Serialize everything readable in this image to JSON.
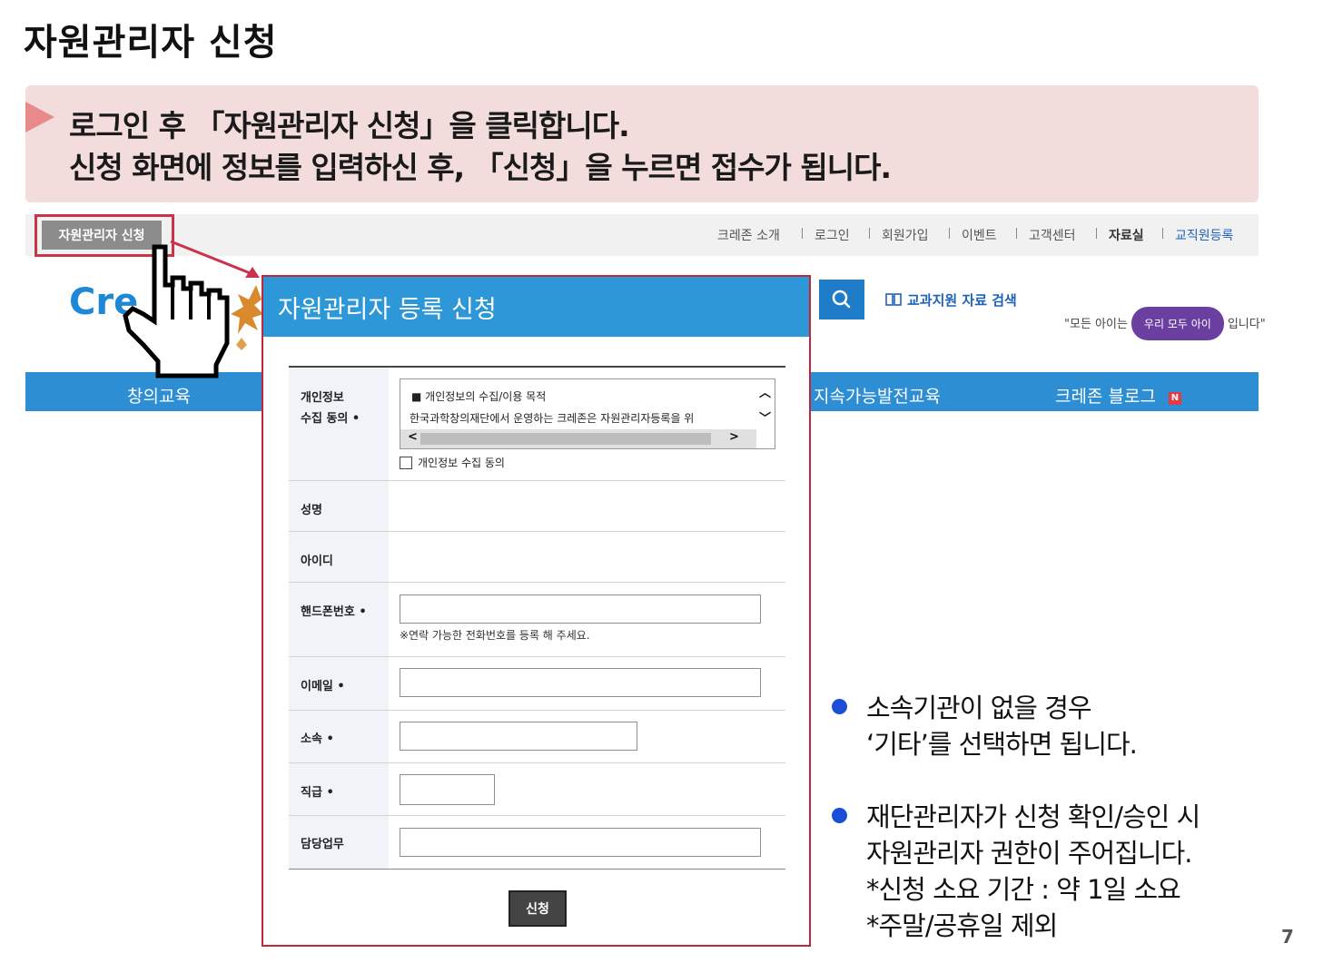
{
  "slide": {
    "title": "자원관리자 신청",
    "page_number": "7"
  },
  "instruction": {
    "line1": "로그인 후 「자원관리자 신청」을 클릭합니다.",
    "line2": "신청 화면에 정보를 입력하신 후, 「신청」을 누르면 접수가 됩니다."
  },
  "site": {
    "apply_button": "자원관리자 신청",
    "top_links": [
      "크레존 소개",
      "로그인",
      "회원가입",
      "이벤트",
      "고객센터",
      "자료실",
      "교직원등록"
    ],
    "logo_text": "Cre",
    "textbook_search": "교과지원 자료 검색",
    "slogan_left": "\"모든 아이는",
    "slogan_mid": "우리 모두",
    "slogan_mid2": "아이",
    "slogan_right": "입니다\"",
    "nav": {
      "left": "창의교육",
      "sustain": "지속가능발전교육",
      "blog": "크레존 블로그",
      "blog_badge": "N"
    }
  },
  "modal": {
    "title": "자원관리자 등록 신청",
    "consent": {
      "label_line1": "개인정보",
      "label_line2": "수집 동의 •",
      "box_title": "■ 개인정보의 수집/이용 목적",
      "box_text": "한국과학창의재단에서 운영하는 크레존은 자원관리자등록을 위",
      "check_label": "개인정보 수집 동의"
    },
    "fields": {
      "name": "성명",
      "id": "아이디",
      "phone": "핸드폰번호 •",
      "phone_hint": "※연락 가능한 전화번호를 등록 해 주세요.",
      "email": "이메일 •",
      "affiliation": "소속 •",
      "position": "직급 •",
      "duty": "담당업무"
    },
    "submit": "신청"
  },
  "notes": [
    {
      "lines": [
        "소속기관이 없을 경우",
        "‘기타’를 선택하면 됩니다."
      ]
    },
    {
      "lines": [
        "재단관리자가 신청 확인/승인 시",
        "자원관리자 권한이 주어집니다.",
        "*신청 소요 기간 : 약 1일 소요",
        "*주말/공휴일 제외"
      ]
    }
  ]
}
